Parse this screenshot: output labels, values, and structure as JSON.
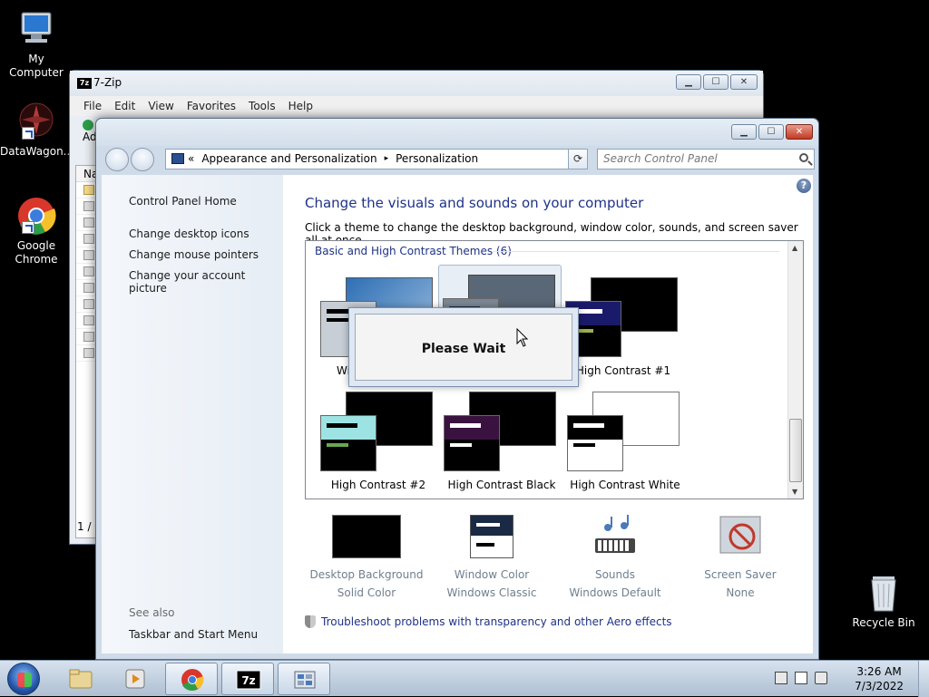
{
  "desktop": {
    "icons": [
      {
        "label": "My Computer"
      },
      {
        "label": "DataWagon..."
      },
      {
        "label": "Google Chrome"
      },
      {
        "label": "Recycle Bin"
      }
    ]
  },
  "zip_window": {
    "title": "7-Zip",
    "menu": [
      "File",
      "Edit",
      "View",
      "Favorites",
      "Tools",
      "Help"
    ],
    "toolbar_partial": "Ad",
    "list_header_partial": "Na",
    "status_partial": "1 / 1"
  },
  "cp_window": {
    "address": {
      "prefix": "«",
      "crumbs": [
        "Appearance and Personalization",
        "Personalization"
      ],
      "separator": "▸"
    },
    "search_placeholder": "Search Control Panel",
    "left_links": [
      "Control Panel Home",
      "Change desktop icons",
      "Change mouse pointers",
      "Change your account picture"
    ],
    "see_also": "See also",
    "see_also_links": [
      "Taskbar and Start Menu"
    ],
    "heading": "Change the visuals and sounds on your computer",
    "subtext": "Click a theme to change the desktop background, window color, sounds, and screen saver all at once.",
    "group_header": "Basic and High Contrast Themes (6)",
    "themes": [
      {
        "label": "Wi",
        "bg": "#4a6f9c",
        "mini": "#c8ced6",
        "bar": "#000000"
      },
      {
        "label": "",
        "bg": "#5a6776",
        "mini": "#7d8895",
        "bar": "#ffffff"
      },
      {
        "label": "High Contrast #1",
        "bg": "#000000",
        "mini": "#1a1a6a",
        "bar": "#ffffff"
      },
      {
        "label": "High Contrast #2",
        "bg": "#000000",
        "mini": "#9ee3e3",
        "bar": "#000000"
      },
      {
        "label": "High Contrast Black",
        "bg": "#000000",
        "mini": "#3a1240",
        "bar": "#ffffff"
      },
      {
        "label": "High Contrast White",
        "bg": "#ffffff",
        "mini": "#000000",
        "bar": "#ffffff"
      }
    ],
    "wait_message": "Please Wait",
    "bottom_items": [
      {
        "title": "Desktop Background",
        "value": "Solid Color"
      },
      {
        "title": "Window Color",
        "value": "Windows Classic"
      },
      {
        "title": "Sounds",
        "value": "Windows Default"
      },
      {
        "title": "Screen Saver",
        "value": "None"
      }
    ],
    "troubleshoot": "Troubleshoot problems with transparency and other Aero effects"
  },
  "taskbar": {
    "time": "3:26 AM",
    "date": "7/3/2022",
    "apps": [
      "explorer",
      "media-player",
      "chrome",
      "7zip",
      "control-panel"
    ]
  }
}
